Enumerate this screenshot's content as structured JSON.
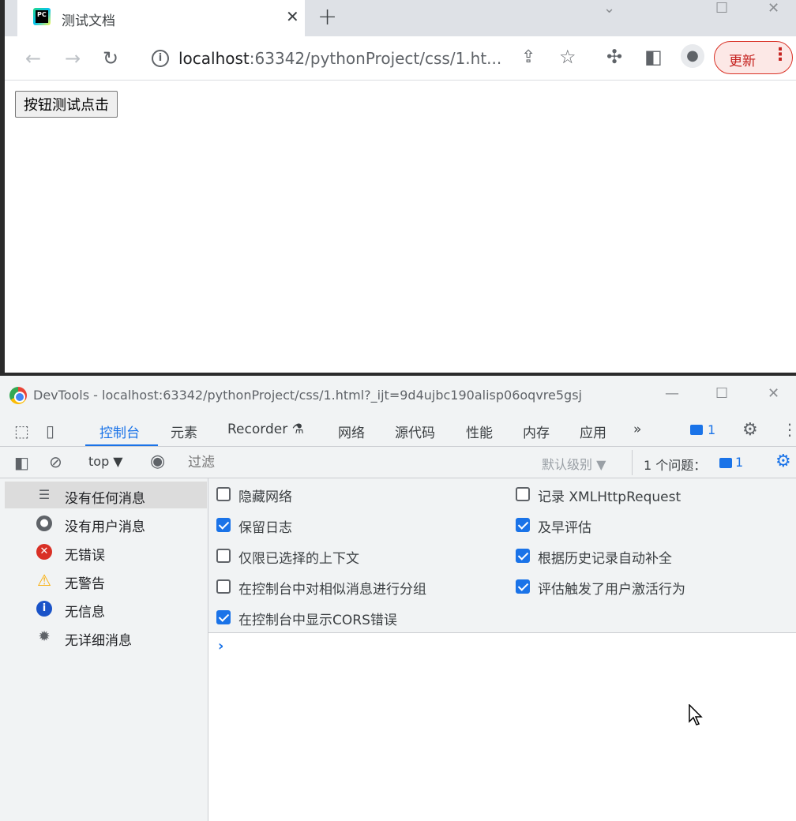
{
  "browser": {
    "tab": {
      "title": "测试文档",
      "favicon_text": "PC"
    },
    "url": {
      "host": "localhost",
      "rest": ":63342/pythonProject/css/1.ht..."
    },
    "update_button": "更新",
    "page": {
      "button_label": "按钮测试点击"
    }
  },
  "devtools": {
    "window_title": "DevTools - localhost:63342/pythonProject/css/1.html?_ijt=9d4ujbc190alisp06oqvre5gsj",
    "tabs": [
      "控制台",
      "元素",
      "Recorder",
      "网络",
      "源代码",
      "性能",
      "内存",
      "应用"
    ],
    "issues_badge_count": "1",
    "filterbar": {
      "context": "top",
      "filter_placeholder": "过滤",
      "level": "默认级别",
      "issues_label": "1 个问题：",
      "issues_count": "1"
    },
    "sidebar": [
      {
        "label": "没有任何消息",
        "icon": "list-icon"
      },
      {
        "label": "没有用户消息",
        "icon": "user-icon"
      },
      {
        "label": "无错误",
        "icon": "error-icon"
      },
      {
        "label": "无警告",
        "icon": "warning-icon"
      },
      {
        "label": "无信息",
        "icon": "info-icon"
      },
      {
        "label": "无详细消息",
        "icon": "bug-icon"
      }
    ],
    "settings": {
      "left": [
        {
          "label": "隐藏网络",
          "checked": false
        },
        {
          "label": "保留日志",
          "checked": true
        },
        {
          "label": "仅限已选择的上下文",
          "checked": false
        },
        {
          "label": "在控制台中对相似消息进行分组",
          "checked": false
        },
        {
          "label": "在控制台中显示CORS错误",
          "checked": true
        }
      ],
      "right": [
        {
          "label": "记录 XMLHttpRequest",
          "checked": false
        },
        {
          "label": "及早评估",
          "checked": true
        },
        {
          "label": "根据历史记录自动补全",
          "checked": true
        },
        {
          "label": "评估触发了用户激活行为",
          "checked": true
        }
      ]
    },
    "prompt": "›"
  }
}
